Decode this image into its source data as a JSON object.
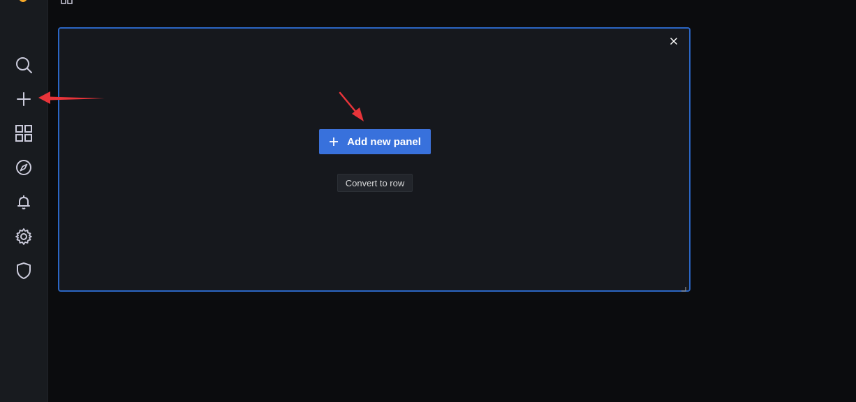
{
  "panel": {
    "add_new_panel_label": "Add new panel",
    "convert_to_row_label": "Convert to row"
  },
  "sidebar": {
    "items": [
      "search-icon",
      "plus-icon",
      "dashboards-icon",
      "explore-icon",
      "alerting-icon",
      "gear-icon",
      "shield-icon"
    ]
  },
  "colors": {
    "accent": "#3871dc",
    "panel_border": "#2b66c4",
    "logo": "#f7a928",
    "annotation_arrow": "#e8343a"
  }
}
